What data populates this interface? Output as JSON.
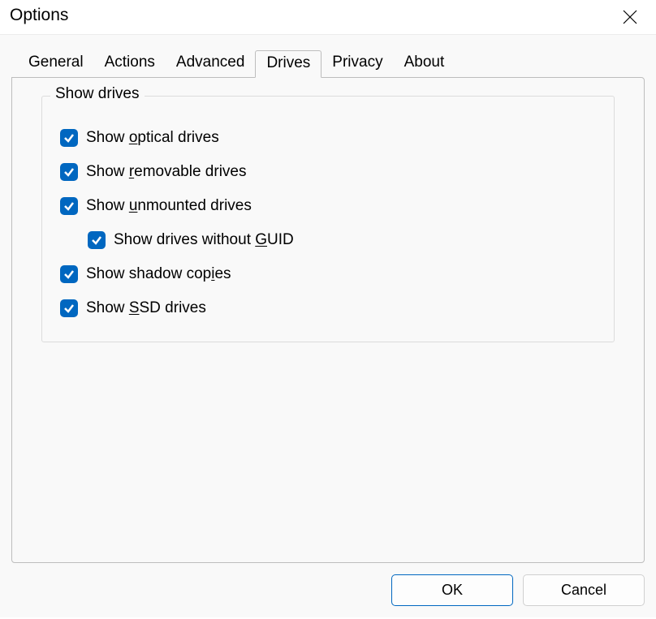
{
  "window": {
    "title": "Options"
  },
  "tabs": {
    "general": "General",
    "actions": "Actions",
    "advanced": "Advanced",
    "drives": "Drives",
    "privacy": "Privacy",
    "about": "About",
    "active": "drives"
  },
  "group": {
    "legend": "Show drives"
  },
  "options": {
    "optical": {
      "pre": "Show ",
      "hot": "o",
      "post": "ptical drives",
      "checked": true
    },
    "removable": {
      "pre": "Show ",
      "hot": "r",
      "post": "emovable drives",
      "checked": true
    },
    "unmounted": {
      "pre": "Show ",
      "hot": "u",
      "post": "nmounted drives",
      "checked": true
    },
    "noguid": {
      "pre": "Show drives without ",
      "hot": "G",
      "post": "UID",
      "checked": true
    },
    "shadow": {
      "pre": "Show shadow cop",
      "hot": "i",
      "post": "es",
      "checked": true
    },
    "ssd": {
      "pre": "Show ",
      "hot": "S",
      "post": "SD drives",
      "checked": true
    }
  },
  "buttons": {
    "ok": "OK",
    "cancel": "Cancel"
  }
}
